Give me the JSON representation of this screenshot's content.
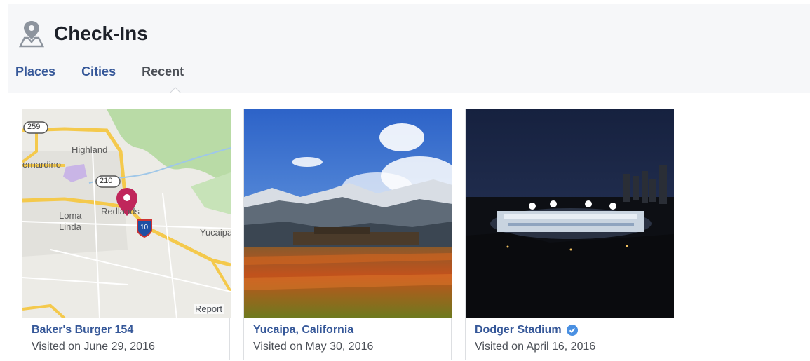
{
  "header": {
    "title": "Check-Ins",
    "icon": "location-pin-person-icon"
  },
  "tabs": [
    {
      "label": "Places",
      "active": false
    },
    {
      "label": "Cities",
      "active": false
    },
    {
      "label": "Recent",
      "active": true
    }
  ],
  "cards": [
    {
      "name": "Baker's Burger 154",
      "date": "Visited on June 29, 2016",
      "image": "map",
      "verified": false,
      "map": {
        "labels": {
          "highland": "Highland",
          "bernardino": "ernardino",
          "loma": "Loma",
          "linda": "Linda",
          "redlands": "Redlands",
          "yucaipa": "Yucaipa",
          "hwy259": "259",
          "hwy210": "210",
          "hwy10": "10"
        },
        "report_label": "Report"
      }
    },
    {
      "name": "Yucaipa, California",
      "date": "Visited on May 30, 2016",
      "image": "mountain-landscape",
      "verified": false
    },
    {
      "name": "Dodger Stadium",
      "date": "Visited on April 16, 2016",
      "image": "stadium-night",
      "verified": true
    }
  ],
  "colors": {
    "link": "#365899",
    "header_bg": "#f6f7f9",
    "pin": "#c0265b",
    "verified": "#4a90e2"
  }
}
